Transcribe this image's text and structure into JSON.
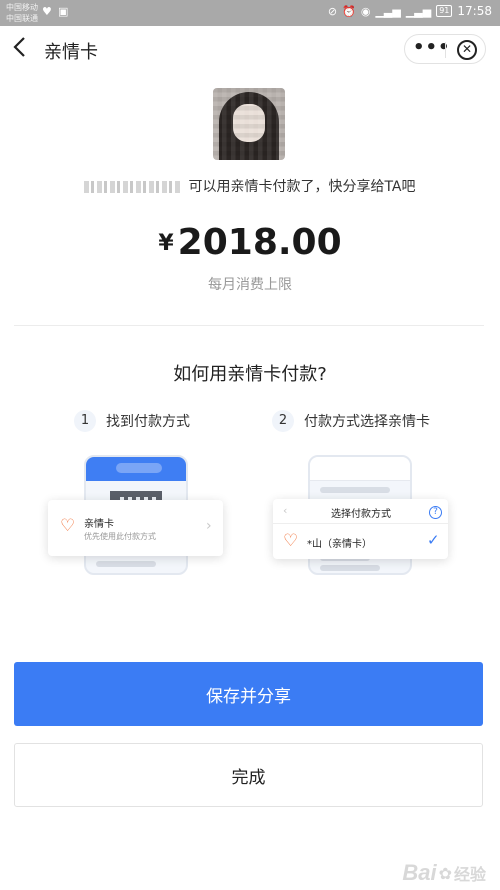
{
  "status_bar": {
    "carrier_1": "中国移动",
    "carrier_2": "中国联通",
    "battery": "91",
    "time": "17:58"
  },
  "nav": {
    "title": "亲情卡",
    "more_label": "•••",
    "close_label": "✕"
  },
  "share": {
    "message": "可以用亲情卡付款了，快分享给TA吧"
  },
  "limit": {
    "currency": "¥",
    "amount": "2018.00",
    "caption": "每月消费上限"
  },
  "howto": {
    "title": "如何用亲情卡付款?",
    "steps": [
      {
        "num": "1",
        "label": "找到付款方式"
      },
      {
        "num": "2",
        "label": "付款方式选择亲情卡"
      }
    ],
    "card1": {
      "title": "亲情卡",
      "subtitle": "优先使用此付款方式"
    },
    "card2": {
      "header": "选择付款方式",
      "option": "*山（亲情卡）"
    }
  },
  "actions": {
    "primary": "保存并分享",
    "secondary": "完成"
  },
  "watermark": {
    "text": "Bai",
    "suffix": "经验"
  },
  "colors": {
    "accent": "#3b7cf4",
    "heart": "#f1733b"
  }
}
